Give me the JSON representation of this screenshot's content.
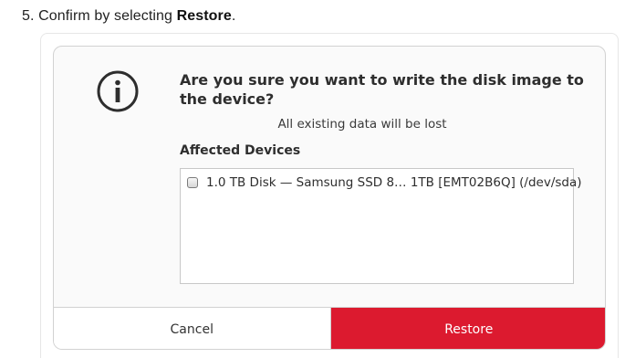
{
  "instruction": {
    "prefix": "5. Confirm by selecting ",
    "emphasis": "Restore",
    "suffix": "."
  },
  "dialog": {
    "icon": "info-icon",
    "title": "Are you sure you want to write the disk image to the device?",
    "subtitle": "All existing data will be lost",
    "section_label": "Affected Devices",
    "devices": [
      {
        "label": "1.0 TB Disk — Samsung SSD 8… 1TB [EMT02B6Q] (/dev/sda)",
        "checked": false
      }
    ],
    "cancel_label": "Cancel",
    "confirm_label": "Restore",
    "colors": {
      "confirm_bg": "#dc1a2f",
      "confirm_text": "#ffffff"
    }
  }
}
